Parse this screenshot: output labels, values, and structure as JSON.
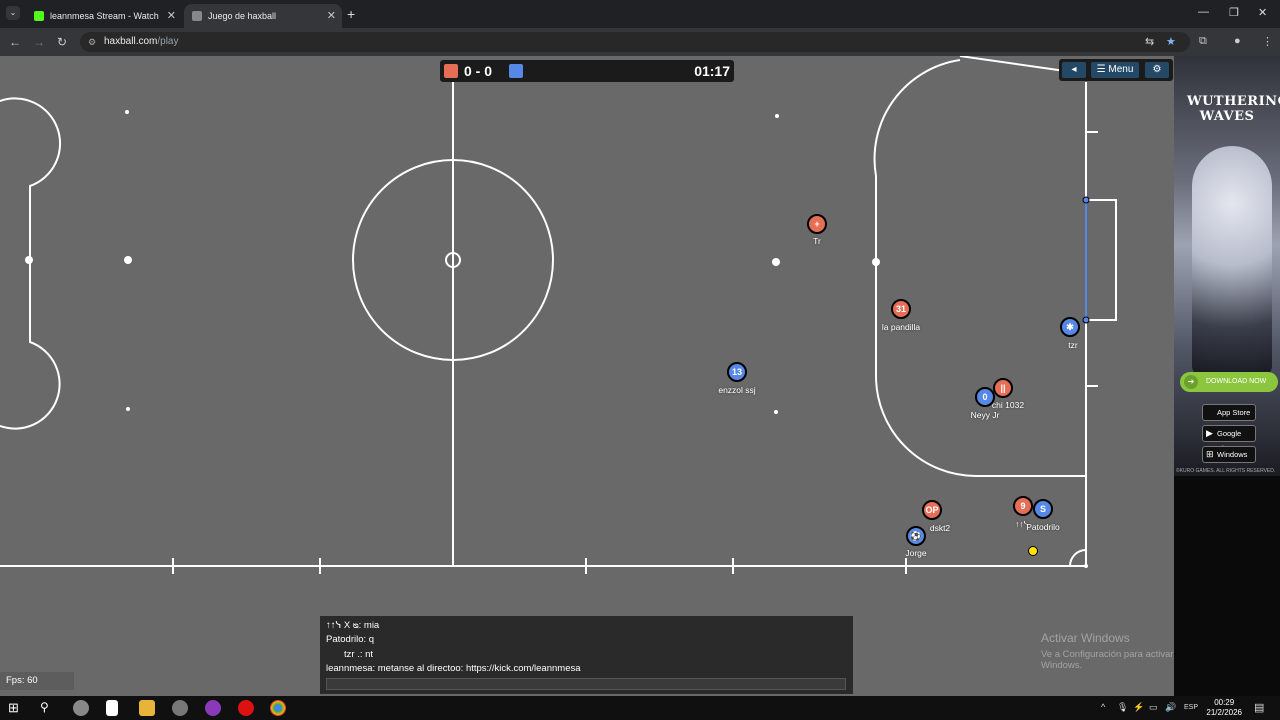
{
  "browser": {
    "tabs": [
      {
        "title": "leannmesa Stream - Watch Live",
        "favicon_color": "#53fc18",
        "active": false
      },
      {
        "title": "Juego de haxball",
        "favicon_color": "#888888",
        "active": true
      }
    ],
    "url_host": "haxball.com",
    "url_path": "/play"
  },
  "game": {
    "score": "0 - 0",
    "time": "01:17",
    "team_colors": {
      "red": "#e56e56",
      "blue": "#5689e5"
    },
    "menu_label": "Menu",
    "players": [
      {
        "team": "red",
        "avatar": "+",
        "name": "Tr"
      },
      {
        "team": "red",
        "avatar": "31",
        "name": "la pandilla"
      },
      {
        "team": "blue",
        "avatar": "13",
        "name": "enzzol ssj"
      },
      {
        "team": "blue",
        "avatar": "✱",
        "name": "tzr"
      },
      {
        "team": "red",
        "avatar": "||",
        "name": "chi 1032"
      },
      {
        "team": "blue",
        "avatar": "0",
        "name": "Neyy Jr"
      },
      {
        "team": "red",
        "avatar": "OP",
        "name": "dskt2"
      },
      {
        "team": "blue",
        "avatar": "⚽",
        "name": "Jorge"
      },
      {
        "team": "red",
        "avatar": "9",
        "name": "↑↑ᓭ"
      },
      {
        "team": "blue",
        "avatar": "S",
        "name": "Patodrilo"
      }
    ],
    "chat": [
      "↑↑ᓭ X ᴓ: mia",
      "Patodrilo: q",
      "tzr .: nt",
      "leannmesa: metanse al directoo: https://kick.com/leannmesa"
    ],
    "fps": "Fps: 60"
  },
  "activate_windows": {
    "title": "Activar Windows",
    "subtitle": "Ve a Configuración para activar Windows."
  },
  "ad": {
    "title": "WUTHERING WAVES",
    "download": "DOWNLOAD NOW",
    "appstore": "App Store",
    "googleplay": "Google Play",
    "windows": "Windows",
    "copyright": "©KURO GAMES. ALL RIGHTS RESERVED."
  },
  "taskbar": {
    "language": "ESP",
    "time": "00:29",
    "date": "21/2/2026"
  }
}
